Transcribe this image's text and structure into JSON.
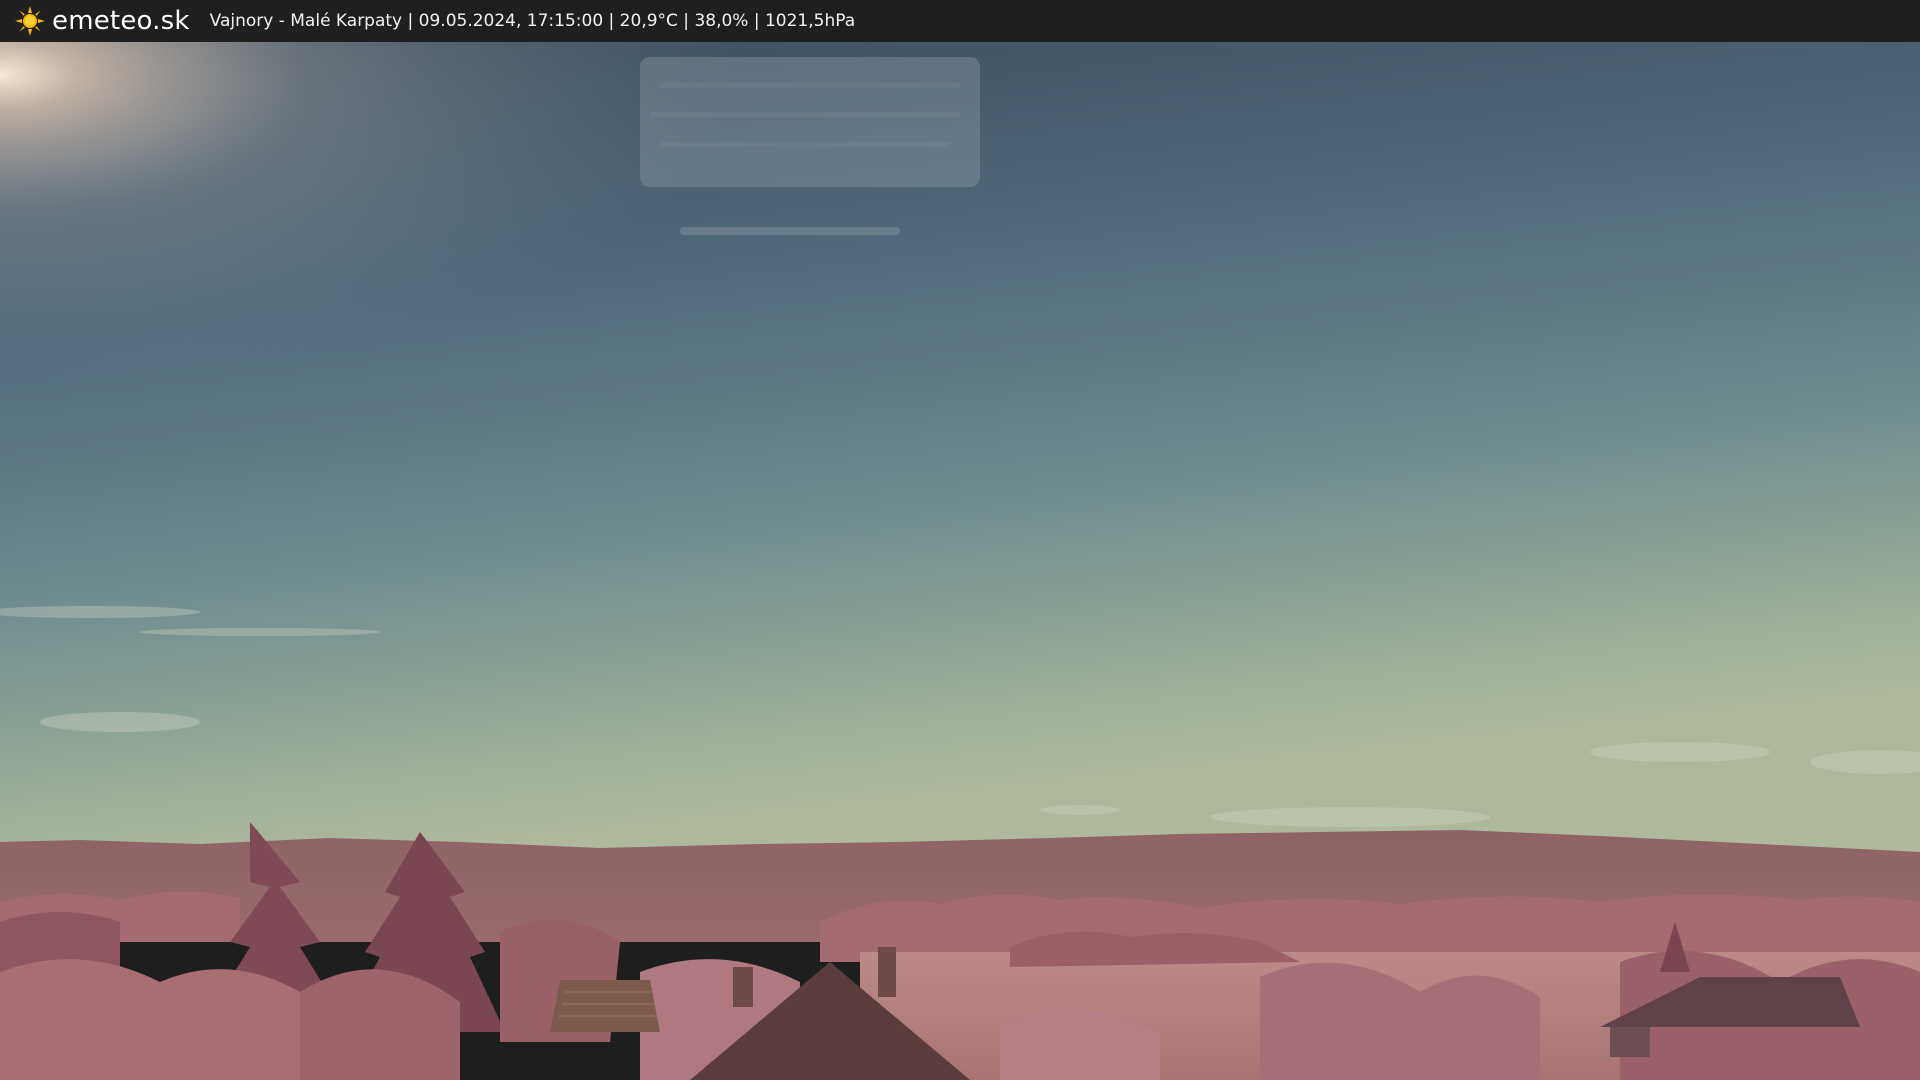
{
  "header": {
    "brand": "emeteo.sk",
    "caption": "Vajnory - Malé Karpaty | 09.05.2024, 17:15:00 | 20,9°C | 38,0% | 1021,5hPa",
    "logo_icon": "sun-icon",
    "sun_color": "#f5b800",
    "bar_color": "#1f1f1f"
  },
  "scene": {
    "sky_top_color": "#39495a",
    "sky_horizon_color": "#a6b59a",
    "vegetation_color": "#a7656f",
    "field_color": "#b98787"
  }
}
